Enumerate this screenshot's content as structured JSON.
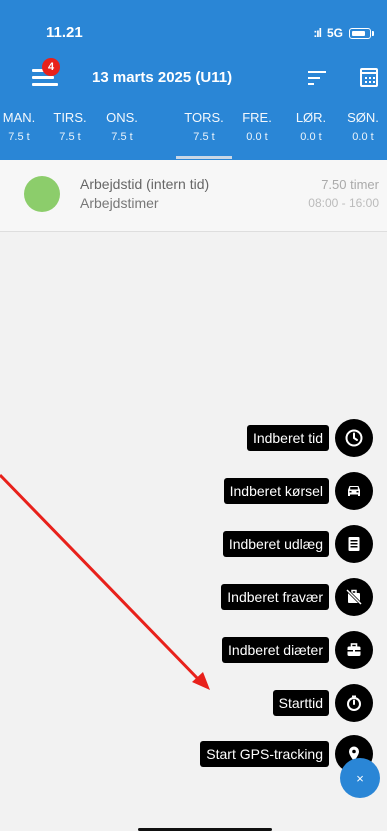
{
  "status_bar": {
    "time": "11.21",
    "network": "5G"
  },
  "header": {
    "notification_count": "4",
    "date_title": "13 marts 2025 (U11)"
  },
  "days": [
    {
      "name": "MAN.",
      "hours": "7.5 t"
    },
    {
      "name": "TIRS.",
      "hours": "7.5 t"
    },
    {
      "name": "ONS.",
      "hours": "7.5 t"
    },
    {
      "name": "TORS.",
      "hours": "7.5 t"
    },
    {
      "name": "FRE.",
      "hours": "0.0 t"
    },
    {
      "name": "LØR.",
      "hours": "0.0 t"
    },
    {
      "name": "SØN.",
      "hours": "0.0 t"
    }
  ],
  "selected_day": "TORS.",
  "entries": [
    {
      "title": "Arbejdstid (intern tid)",
      "subtitle": "Arbejdstimer",
      "amount": "7.50 timer",
      "time_range": "08:00 - 16:00",
      "color": "#8ccd6b"
    }
  ],
  "fab_menu": [
    {
      "label": "Indberet tid",
      "icon": "clock-icon"
    },
    {
      "label": "Indberet kørsel",
      "icon": "car-icon"
    },
    {
      "label": "Indberet udlæg",
      "icon": "receipt-icon"
    },
    {
      "label": "Indberet fravær",
      "icon": "suitcase-off-icon"
    },
    {
      "label": "Indberet diæter",
      "icon": "briefcase-icon"
    },
    {
      "label": "Starttid",
      "icon": "stopwatch-icon"
    },
    {
      "label": "Start GPS-tracking",
      "icon": "map-pin-icon"
    }
  ],
  "close_button": {
    "label": "×"
  },
  "colors": {
    "primary": "#2a86d6",
    "annotation_arrow": "#e8211b"
  }
}
